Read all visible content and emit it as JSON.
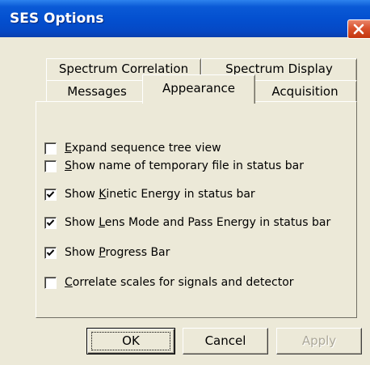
{
  "window": {
    "title": "SES Options",
    "close_icon": "close-icon"
  },
  "tabs": {
    "row_back": [
      {
        "label": "Spectrum Correlation"
      },
      {
        "label": "Spectrum Display"
      }
    ],
    "row_front": [
      {
        "label": "Messages"
      },
      {
        "label": "Appearance",
        "selected": true
      },
      {
        "label": "Acquisition"
      }
    ]
  },
  "options": [
    {
      "pre": "",
      "mnemonic": "E",
      "post": "xpand sequence tree view",
      "checked": false
    },
    {
      "pre": "",
      "mnemonic": "S",
      "post": "how name of temporary file in status bar",
      "checked": false
    },
    {
      "pre": "Show ",
      "mnemonic": "K",
      "post": "inetic Energy in status bar",
      "checked": true
    },
    {
      "pre": "Show ",
      "mnemonic": "L",
      "post": "ens Mode and Pass Energy in status bar",
      "checked": true
    },
    {
      "pre": "Show ",
      "mnemonic": "P",
      "post": "rogress Bar",
      "checked": true
    },
    {
      "pre": "",
      "mnemonic": "C",
      "post": "orrelate scales for signals and detector",
      "checked": false
    }
  ],
  "buttons": {
    "ok": "OK",
    "cancel": "Cancel",
    "apply": "Apply"
  },
  "colors": {
    "titlebar": "#0450d0",
    "close": "#d9522e",
    "face": "#ece9d8"
  }
}
